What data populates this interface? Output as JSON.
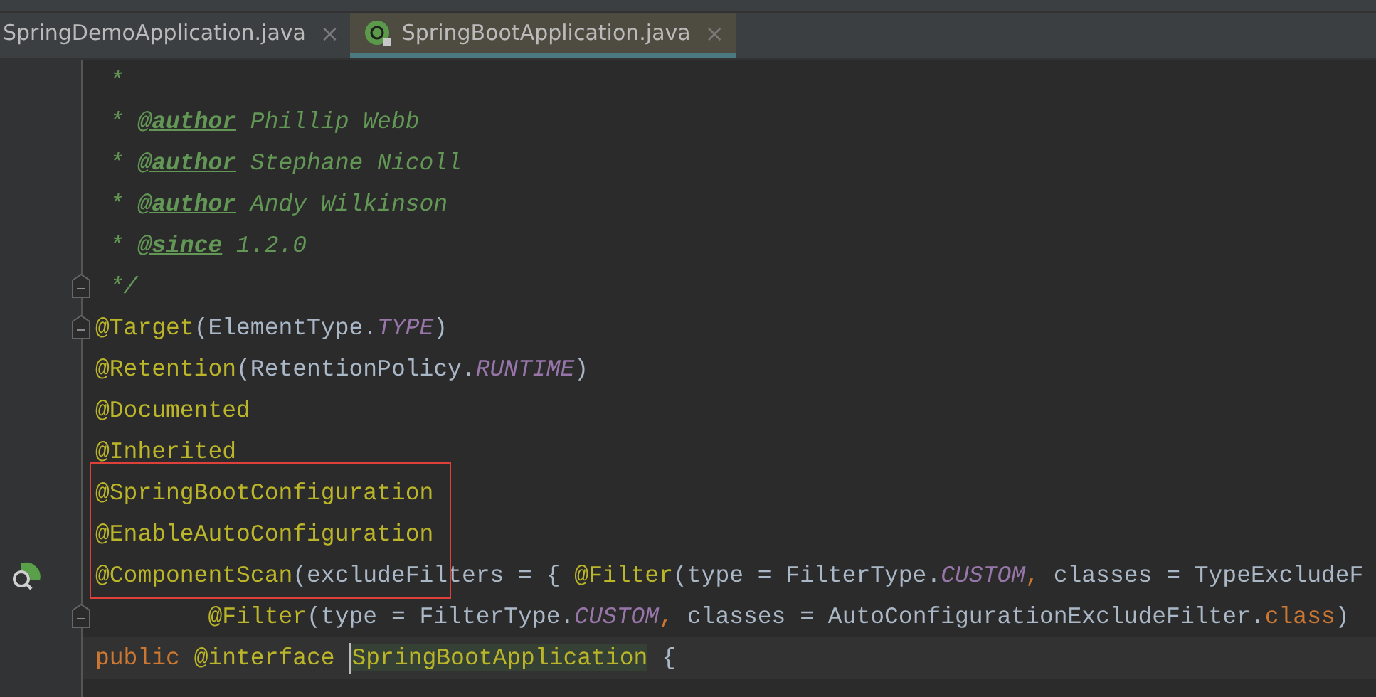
{
  "tabs": [
    {
      "label": "SpringDemoApplication.java",
      "selected": false,
      "close": "×"
    },
    {
      "label": "SpringBootApplication.java",
      "selected": true,
      "close": "×"
    }
  ],
  "editor": {
    "lines": [
      {
        "tokens": [
          {
            "kind": "comment",
            "text": " *"
          }
        ]
      },
      {
        "tokens": [
          {
            "kind": "comment",
            "text": " * "
          },
          {
            "kind": "doctag",
            "text": "@author"
          },
          {
            "kind": "comment",
            "text": " Phillip Webb"
          }
        ]
      },
      {
        "tokens": [
          {
            "kind": "comment",
            "text": " * "
          },
          {
            "kind": "doctag",
            "text": "@author"
          },
          {
            "kind": "comment",
            "text": " Stephane Nicoll"
          }
        ]
      },
      {
        "tokens": [
          {
            "kind": "comment",
            "text": " * "
          },
          {
            "kind": "doctag",
            "text": "@author"
          },
          {
            "kind": "comment",
            "text": " Andy Wilkinson"
          }
        ]
      },
      {
        "tokens": [
          {
            "kind": "comment",
            "text": " * "
          },
          {
            "kind": "doctag",
            "text": "@since"
          },
          {
            "kind": "comment",
            "text": " 1.2.0"
          }
        ]
      },
      {
        "fold": true,
        "tokens": [
          {
            "kind": "comment",
            "text": " */"
          }
        ]
      },
      {
        "fold": true,
        "tokens": [
          {
            "kind": "annotation",
            "text": "@Target"
          },
          {
            "kind": "plain",
            "text": "(ElementType."
          },
          {
            "kind": "constant",
            "text": "TYPE"
          },
          {
            "kind": "plain",
            "text": ")"
          }
        ]
      },
      {
        "tokens": [
          {
            "kind": "annotation",
            "text": "@Retention"
          },
          {
            "kind": "plain",
            "text": "(RetentionPolicy."
          },
          {
            "kind": "constant",
            "text": "RUNTIME"
          },
          {
            "kind": "plain",
            "text": ")"
          }
        ]
      },
      {
        "tokens": [
          {
            "kind": "annotation",
            "text": "@Documented"
          }
        ]
      },
      {
        "tokens": [
          {
            "kind": "annotation",
            "text": "@Inherited"
          }
        ]
      },
      {
        "tokens": [
          {
            "kind": "annotation",
            "text": "@SpringBootConfiguration"
          }
        ]
      },
      {
        "tokens": [
          {
            "kind": "annotation",
            "text": "@EnableAutoConfiguration"
          }
        ]
      },
      {
        "gutter_icon": true,
        "tokens": [
          {
            "kind": "annotation",
            "text": "@ComponentScan"
          },
          {
            "kind": "plain",
            "text": "(excludeFilters = { "
          },
          {
            "kind": "annotation",
            "text": "@Filter"
          },
          {
            "kind": "plain",
            "text": "(type = FilterType."
          },
          {
            "kind": "constant",
            "text": "CUSTOM"
          },
          {
            "kind": "keyword",
            "text": ","
          },
          {
            "kind": "plain",
            "text": " classes = TypeExcludeF"
          }
        ]
      },
      {
        "fold": true,
        "tokens": [
          {
            "kind": "annotation",
            "text": "        @Filter"
          },
          {
            "kind": "plain",
            "text": "(type = FilterType."
          },
          {
            "kind": "constant",
            "text": "CUSTOM"
          },
          {
            "kind": "keyword",
            "text": ","
          },
          {
            "kind": "plain",
            "text": " classes = AutoConfigurationExcludeFilter."
          },
          {
            "kind": "keyword",
            "text": "class"
          },
          {
            "kind": "plain",
            "text": ")"
          }
        ]
      },
      {
        "current": true,
        "tokens": [
          {
            "kind": "keyword",
            "text": "public "
          },
          {
            "kind": "annotation",
            "text": "@interface "
          },
          {
            "kind": "highlight",
            "text": "SpringBootApplication",
            "caret": true
          },
          {
            "kind": "plain",
            "text": " {"
          }
        ]
      }
    ]
  }
}
